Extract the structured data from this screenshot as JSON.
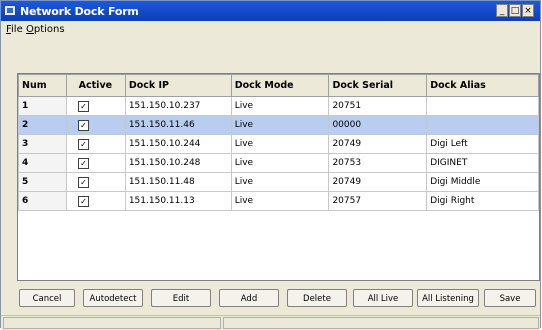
{
  "window": {
    "title": "Network Dock Form",
    "controls": [
      "_",
      "□",
      "×"
    ]
  },
  "menu": [
    {
      "label": "File",
      "mnemonic": "F"
    },
    {
      "label": "Options",
      "mnemonic": "O"
    }
  ],
  "grid": {
    "columns": [
      "Num",
      "Active",
      "Dock IP",
      "Dock Mode",
      "Dock Serial",
      "Dock Alias"
    ],
    "selected_row": 2,
    "rows": [
      {
        "num": "1",
        "active": true,
        "ip": "151.150.10.237",
        "mode": "Live",
        "serial": "20751",
        "alias": ""
      },
      {
        "num": "2",
        "active": true,
        "ip": "151.150.11.46",
        "mode": "Live",
        "serial": "00000",
        "alias": ""
      },
      {
        "num": "3",
        "active": true,
        "ip": "151.150.10.244",
        "mode": "Live",
        "serial": "20749",
        "alias": "Digi Left"
      },
      {
        "num": "4",
        "active": true,
        "ip": "151.150.10.248",
        "mode": "Live",
        "serial": "20753",
        "alias": "DIGINET"
      },
      {
        "num": "5",
        "active": true,
        "ip": "151.150.11.48",
        "mode": "Live",
        "serial": "20749",
        "alias": "Digi Middle"
      },
      {
        "num": "6",
        "active": true,
        "ip": "151.150.11.13",
        "mode": "Live",
        "serial": "20757",
        "alias": "Digi Right"
      }
    ]
  },
  "buttons": {
    "cancel": "Cancel",
    "autodetect": "Autodetect",
    "edit": "Edit",
    "add": "Add",
    "delete": "Delete",
    "all_live": "All Live",
    "all_listening": "All Listening",
    "save": "Save"
  },
  "colors": {
    "titlebar": "#0a3fb8",
    "selection": "#b9cdf0",
    "face": "#ece9d8"
  }
}
